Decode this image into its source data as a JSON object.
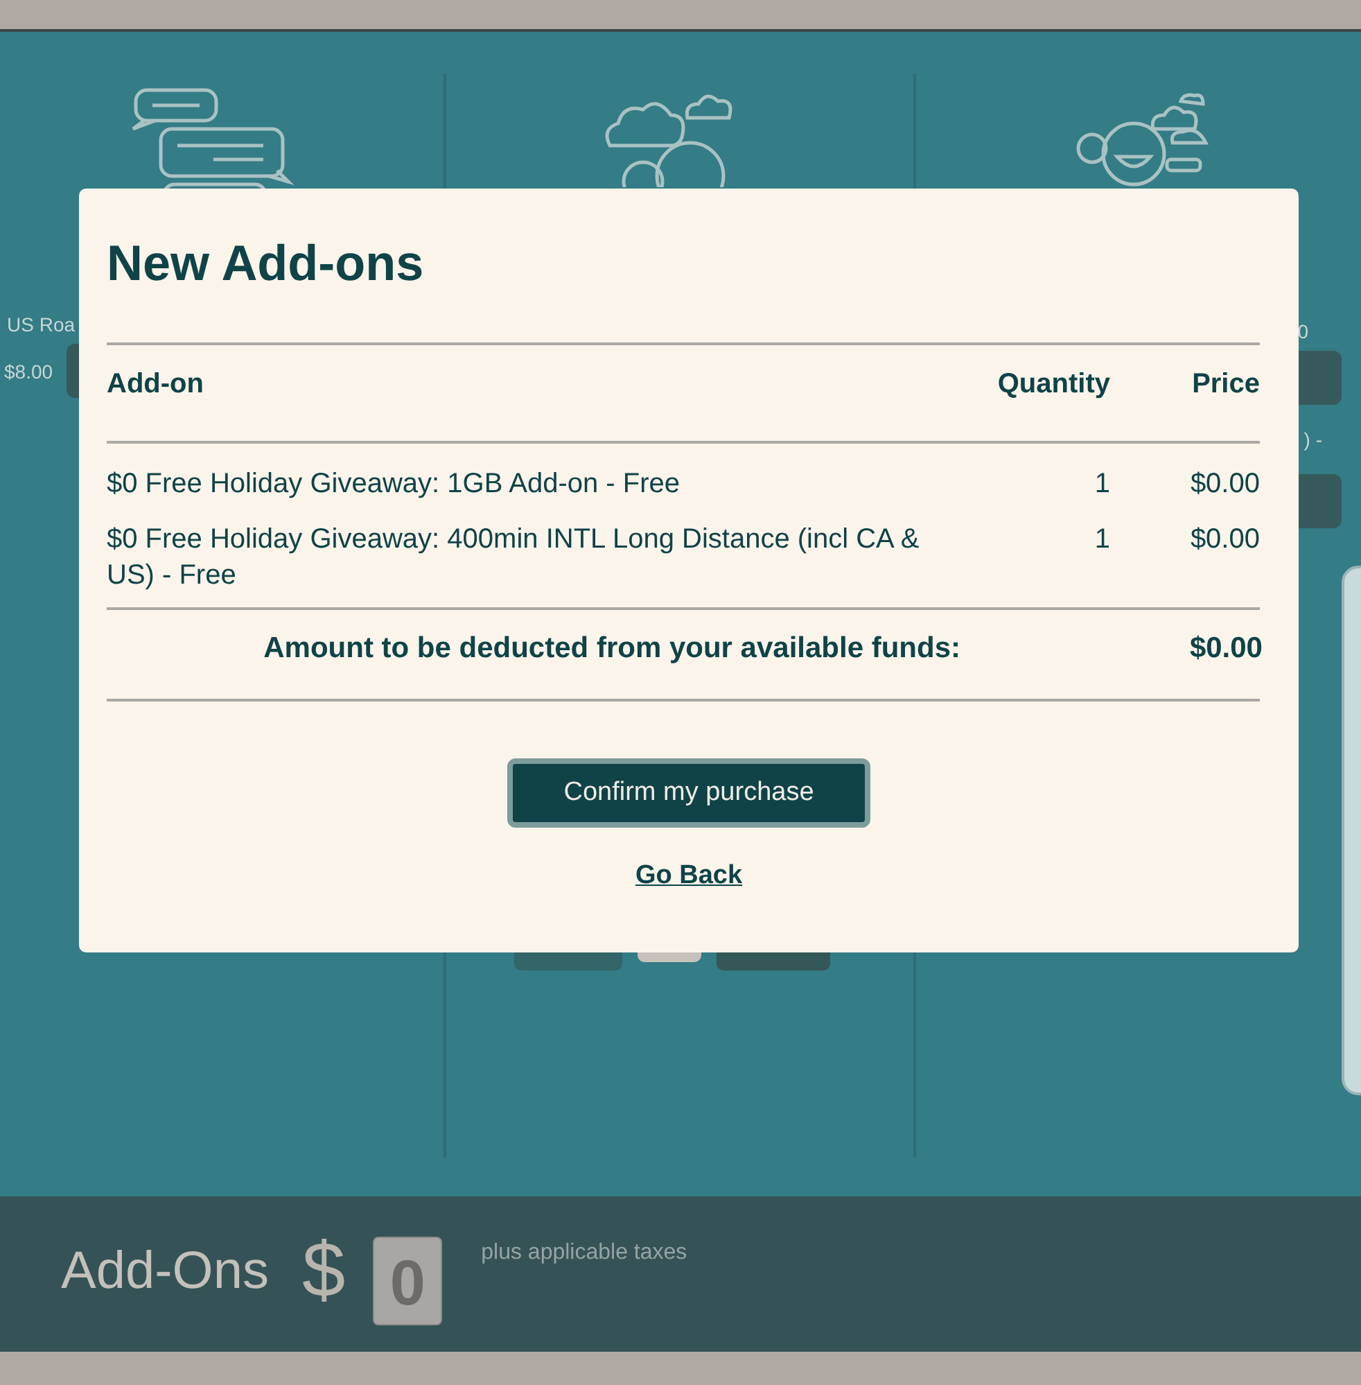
{
  "background": {
    "column_1": {
      "label": "US Roa",
      "price": "$8.00"
    },
    "column_3": {
      "label": "0",
      "note": ") -"
    }
  },
  "modal": {
    "title": "New Add-ons",
    "columns": [
      "Add-on",
      "Quantity",
      "Price"
    ],
    "rows": [
      {
        "name": "$0 Free Holiday Giveaway: 1GB Add-on - Free",
        "quantity": "1",
        "price": "$0.00"
      },
      {
        "name": "$0 Free Holiday Giveaway: 400min INTL Long Distance (incl CA & US) - Free",
        "quantity": "1",
        "price": "$0.00"
      }
    ],
    "total": {
      "label": "Amount to be deducted from your available funds:",
      "value": "$0.00"
    },
    "confirm_button": "Confirm my purchase",
    "back_link": "Go Back"
  },
  "footer": {
    "title": "Add-Ons",
    "currency": "$",
    "amount": "0",
    "note": "plus applicable taxes"
  }
}
